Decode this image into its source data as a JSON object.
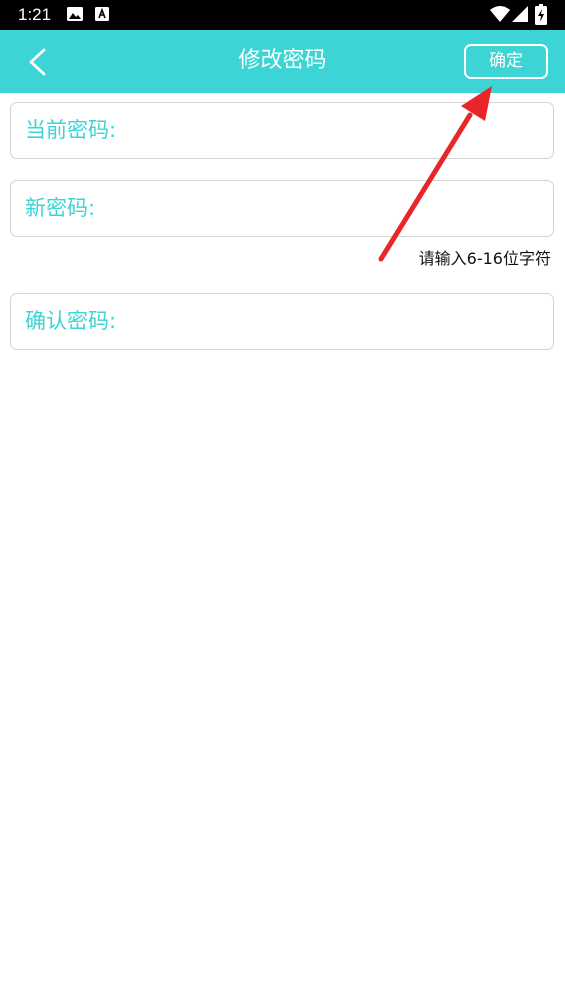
{
  "status_bar": {
    "time": "1:21",
    "icons": [
      "image-icon",
      "text-a-icon",
      "wifi-icon",
      "signal-icon",
      "battery-charging-icon"
    ]
  },
  "header": {
    "title": "修改密码",
    "back_icon": "chevron-left-icon",
    "confirm_label": "确定",
    "background_color": "#3cd4d4"
  },
  "form": {
    "current_password_label": "当前密码:",
    "new_password_label": "新密码:",
    "new_password_hint": "请输入6-16位字符",
    "confirm_password_label": "确认密码:",
    "label_color": "#3cd4d4"
  },
  "annotation": {
    "arrow_color": "#e8262a"
  }
}
